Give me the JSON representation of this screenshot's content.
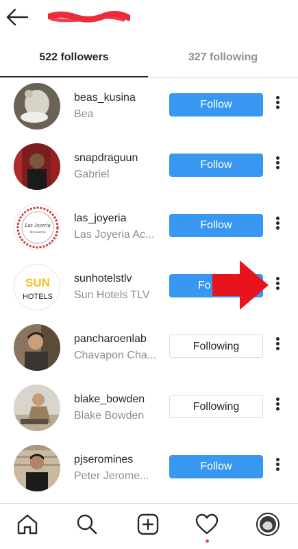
{
  "header": {
    "back_icon": "arrow-left-icon",
    "title": ""
  },
  "tabs": [
    {
      "label": "522 followers",
      "active": true
    },
    {
      "label": "327 following",
      "active": false
    }
  ],
  "colors": {
    "follow_blue": "#3897f0",
    "annotation_red": "#e8141c",
    "text_secondary": "#8e8e8e"
  },
  "accounts": [
    {
      "username": "beas_kusina",
      "name": "Bea",
      "button": "Follow"
    },
    {
      "username": "snapdraguun",
      "name": "Gabriel",
      "button": "Follow"
    },
    {
      "username": "las_joyeria",
      "name": "Las Joyeria Ac...",
      "button": "Follow"
    },
    {
      "username": "sunhotelstlv",
      "name": "Sun Hotels TLV",
      "button": "Fo"
    },
    {
      "username": "pancharoenlab",
      "name": "Chavapon Cha...",
      "button": "Following"
    },
    {
      "username": "blake_bowden",
      "name": "Blake Bowden",
      "button": "Following"
    },
    {
      "username": "pjseromines",
      "name": "Peter Jerome...",
      "button": "Follow"
    }
  ],
  "avatar_text": {
    "las_joyeria_line1": "Las Joyeria",
    "las_joyeria_line2": "Accessories",
    "sun_line1": "SUN",
    "sun_line2": "HOTELS"
  },
  "bottom_nav": [
    "home-icon",
    "search-icon",
    "new-post-icon",
    "activity-heart-icon",
    "profile-avatar-icon"
  ]
}
